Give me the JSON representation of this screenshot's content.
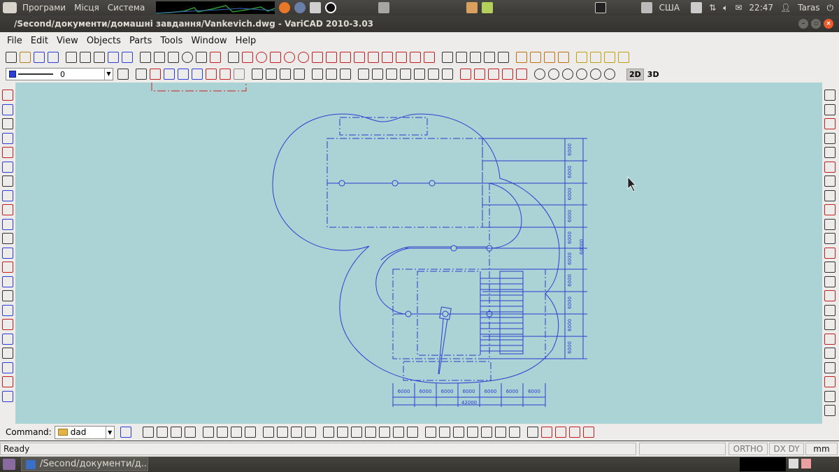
{
  "top_panel": {
    "menus": [
      "Програми",
      "Місця",
      "Система"
    ],
    "keyboard": "США",
    "time": "22:47",
    "user": "Taras"
  },
  "window": {
    "title": "/Second/документи/домашні завдання/Vankevich.dwg - VariCAD 2010-3.03"
  },
  "menubar": [
    "File",
    "Edit",
    "View",
    "Objects",
    "Parts",
    "Tools",
    "Window",
    "Help"
  ],
  "toolbar2": {
    "layer_value": "0",
    "mode_2d": "2D",
    "mode_3d": "3D"
  },
  "drawing": {
    "dims_bottom": [
      "6000",
      "6000",
      "6000",
      "6000",
      "6000",
      "6000",
      "6000"
    ],
    "total_bottom": "42000",
    "dims_right": [
      "6000",
      "6000",
      "6000",
      "6000",
      "6000",
      "6000",
      "6000",
      "6000",
      "6000",
      "6000",
      "6000"
    ],
    "total_right": "60000"
  },
  "command": {
    "label": "Command:",
    "value": "dad"
  },
  "status": {
    "text": "Ready",
    "ortho": "ORTHO",
    "dxdy": "DX DY",
    "units": "mm"
  },
  "taskbar": {
    "task": "/Second/документи/д..."
  },
  "colors": {
    "canvas": "#abd2d5",
    "drawing": "#2a3fd0",
    "accent_red": "#d22020"
  }
}
